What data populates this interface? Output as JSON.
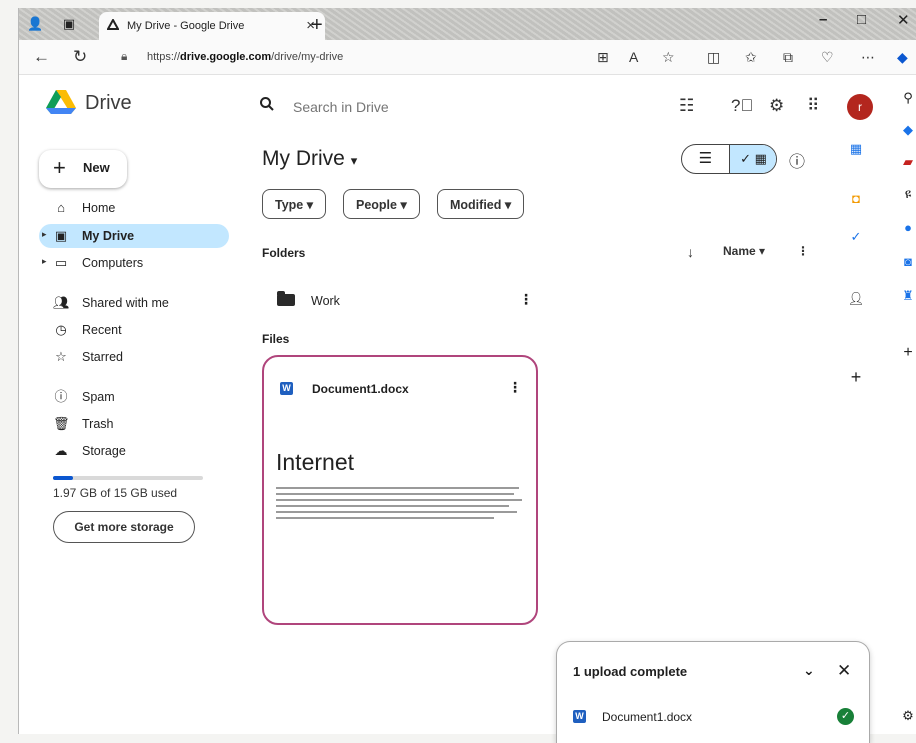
{
  "browser": {
    "tab_title": "My Drive - Google Drive",
    "tab_close": "×",
    "new_tab": "+",
    "url_prefix": "https://",
    "url_host": "drive.google.com",
    "url_path": "/drive/my-drive",
    "window_controls": {
      "minimize": "–",
      "maximize": "□",
      "close": "✕"
    }
  },
  "header": {
    "app_name": "Drive",
    "search_placeholder": "Search in Drive",
    "avatar_letter": "r"
  },
  "sidebar": {
    "new_label": "New",
    "items": [
      {
        "label": "Home",
        "icon": "home-icon"
      },
      {
        "label": "My Drive",
        "icon": "my-drive-icon"
      },
      {
        "label": "Computers",
        "icon": "computers-icon"
      },
      {
        "label": "Shared with me",
        "icon": "shared-icon"
      },
      {
        "label": "Recent",
        "icon": "clock-icon"
      },
      {
        "label": "Starred",
        "icon": "star-icon"
      },
      {
        "label": "Spam",
        "icon": "spam-icon"
      },
      {
        "label": "Trash",
        "icon": "trash-icon"
      },
      {
        "label": "Storage",
        "icon": "cloud-icon"
      }
    ],
    "storage_text": "1.97 GB of 15 GB used",
    "storage_used_fraction": 0.13,
    "get_more_label": "Get more storage"
  },
  "main": {
    "page_title": "My Drive",
    "filters": [
      "Type",
      "People",
      "Modified"
    ],
    "folders_heading": "Folders",
    "files_heading": "Files",
    "sort_label": "Name",
    "folders": [
      {
        "name": "Work"
      }
    ],
    "files": [
      {
        "name": "Document1.docx",
        "preview_title": "Internet"
      }
    ]
  },
  "upload_toast": {
    "title": "1 upload complete",
    "file_name": "Document1.docx"
  },
  "colors": {
    "accent": "#0b57d0",
    "selected_bg": "#c2e7ff",
    "card_border": "#b0457c",
    "avatar": "#b3261e",
    "success": "#188038"
  }
}
